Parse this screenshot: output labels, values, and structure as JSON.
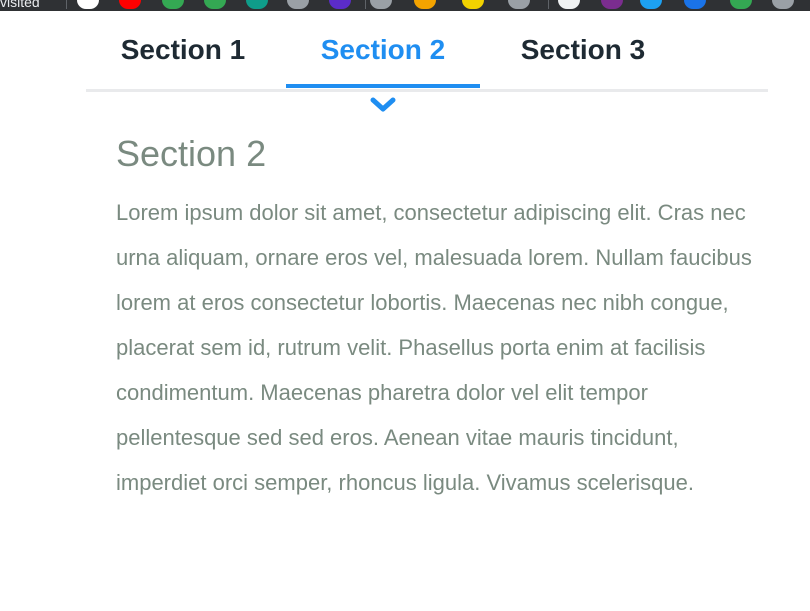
{
  "bookmarks": {
    "label": "visited",
    "icons": [
      {
        "name": "wikipedia-icon",
        "color": "#ffffff"
      },
      {
        "name": "youtube-icon",
        "color": "#ff0000"
      },
      {
        "name": "green-circle-icon",
        "color": "#34a853"
      },
      {
        "name": "green-circle-icon-2",
        "color": "#34a853"
      },
      {
        "name": "teal-app-icon",
        "color": "#0f9d8a"
      },
      {
        "name": "globe-icon",
        "color": "#9aa0a6"
      },
      {
        "name": "purple-app-icon",
        "color": "#5b2cc9"
      },
      {
        "name": "globe-icon-2",
        "color": "#9aa0a6"
      },
      {
        "name": "orange-app-icon",
        "color": "#f4a300"
      },
      {
        "name": "yellow-app-icon",
        "color": "#f2d200"
      },
      {
        "name": "grey-app-icon",
        "color": "#9aa0a6"
      },
      {
        "name": "white-app-icon",
        "color": "#f1f3f4"
      },
      {
        "name": "purple-app-icon-2",
        "color": "#7b2d8f"
      },
      {
        "name": "blue-app-icon",
        "color": "#1da1f2"
      },
      {
        "name": "blue-circle-icon",
        "color": "#1a73e8"
      },
      {
        "name": "green-app-icon",
        "color": "#34a853"
      },
      {
        "name": "globe-icon-3",
        "color": "#9aa0a6"
      }
    ]
  },
  "tabs": [
    {
      "label": "Section 1",
      "active": false
    },
    {
      "label": "Section 2",
      "active": true
    },
    {
      "label": "Section 3",
      "active": false
    }
  ],
  "accent_color": "#1f8ef1",
  "chevron_icon": "chevron-down-icon",
  "content": {
    "heading": "Section 2",
    "body": "Lorem ipsum dolor sit amet, consectetur adipiscing elit. Cras nec urna aliquam, ornare eros vel, malesuada lorem. Nullam faucibus lorem at eros consectetur lobortis. Maecenas nec nibh congue, placerat sem id, rutrum velit. Phasellus porta enim at facilisis condimentum. Maecenas pharetra dolor vel elit tempor pellentesque sed sed eros. Aenean vitae mauris tincidunt, imperdiet orci semper, rhoncus ligula. Vivamus scelerisque."
  }
}
